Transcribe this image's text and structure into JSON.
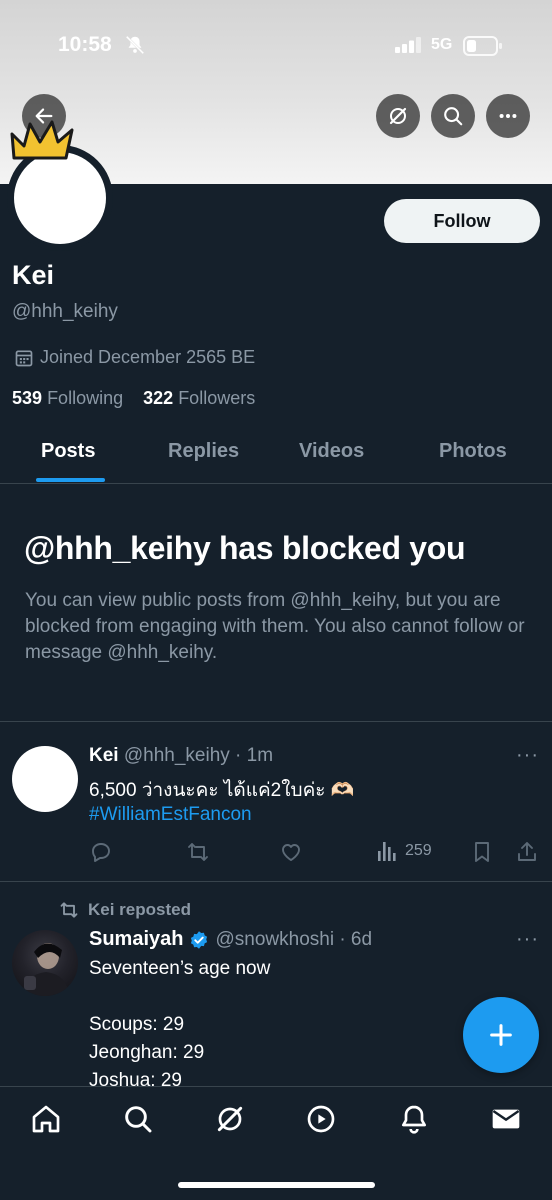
{
  "status_bar": {
    "time": "10:58",
    "network": "5G"
  },
  "header": {
    "icons": [
      "back-arrow-icon",
      "grok-icon",
      "search-icon",
      "more-icon"
    ]
  },
  "profile": {
    "name": "Kei",
    "handle": "@hhh_keihy",
    "joined": "Joined December 2565 BE",
    "following_count": "539",
    "following_label": "Following",
    "followers_count": "322",
    "followers_label": "Followers",
    "follow_label": "Follow"
  },
  "tabs": [
    {
      "label": "Posts",
      "active": true
    },
    {
      "label": "Replies",
      "active": false
    },
    {
      "label": "Videos",
      "active": false
    },
    {
      "label": "Photos",
      "active": false
    }
  ],
  "blocked": {
    "title": "@hhh_keihy has blocked you",
    "message": "You can view public posts from @hhh_keihy, but you are blocked from engaging with them. You also cannot follow or message @hhh_keihy."
  },
  "post": {
    "author": "Kei",
    "meta": "@hhh_keihy · 1m",
    "text": "6,500 ว่างนะคะ ได้แค่2ใบค่ะ 🫶🏻",
    "hashtag": "#WilliamEstFancon",
    "views": "259"
  },
  "repost": {
    "label": "Kei reposted",
    "author": "Sumaiyah",
    "meta": "@snowkhoshi · 6d",
    "lines": [
      "Seventeen’s age now",
      "",
      "Scoups: 29",
      "Jeonghan: 29",
      "Joshua: 29"
    ]
  },
  "accent_color": "#1d9bf0",
  "background_color": "#15202b"
}
